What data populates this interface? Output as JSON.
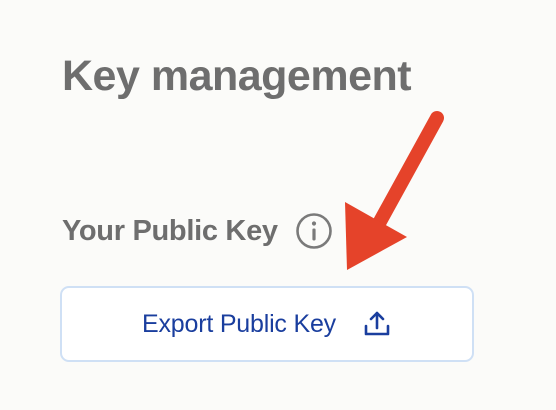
{
  "page": {
    "title": "Key management"
  },
  "public_key": {
    "label": "Your Public Key",
    "info_icon": "info-circle-icon",
    "export_button_label": "Export Public Key",
    "export_icon": "upload-icon"
  },
  "annotation": {
    "arrow_icon": "red-arrow-annotation",
    "arrow_color": "#e5432a"
  },
  "colors": {
    "background": "#fbfbf9",
    "heading_text": "#6e6e6e",
    "button_text": "#1a3e9e",
    "button_border": "#cfe0f5"
  }
}
